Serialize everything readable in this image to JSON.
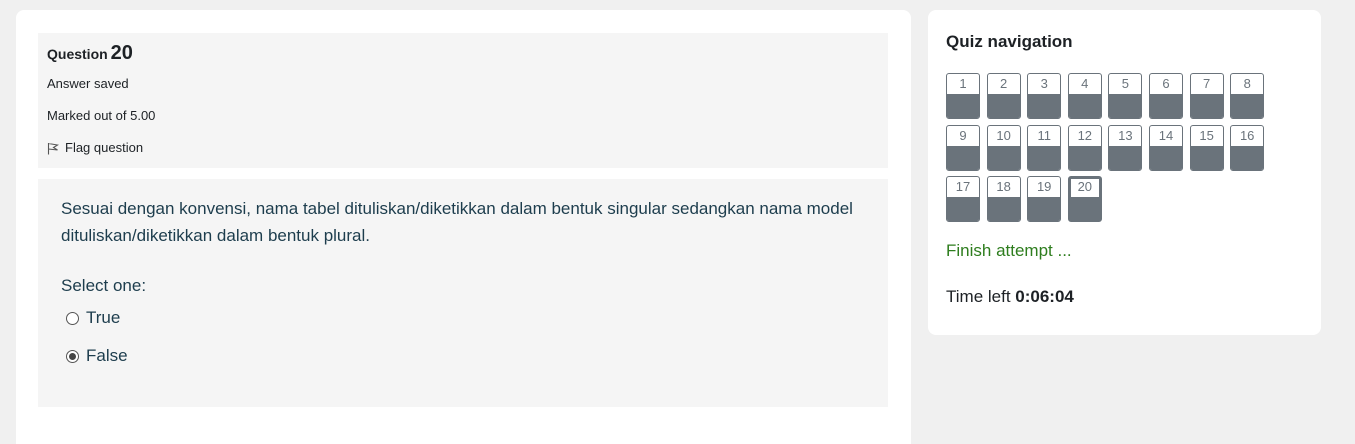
{
  "question": {
    "word": "Question",
    "number": "20",
    "state": "Answer saved",
    "grade": "Marked out of 5.00",
    "flag_label": "Flag question",
    "text": "Sesuai dengan konvensi, nama tabel dituliskan/diketikkan dalam bentuk singular sedangkan nama model dituliskan/diketikkan dalam bentuk plural.",
    "prompt": "Select one:",
    "options": [
      {
        "label": "True",
        "selected": false
      },
      {
        "label": "False",
        "selected": true
      }
    ]
  },
  "navigation": {
    "title": "Quiz navigation",
    "buttons": [
      "1",
      "2",
      "3",
      "4",
      "5",
      "6",
      "7",
      "8",
      "9",
      "10",
      "11",
      "12",
      "13",
      "14",
      "15",
      "16",
      "17",
      "18",
      "19",
      "20"
    ],
    "current": "20",
    "finish_label": "Finish attempt ...",
    "time_label": "Time left",
    "time_value": "0:06:04"
  },
  "colors": {
    "answered_fill": "#6a737b",
    "finish_link": "#2e7d1e",
    "question_text": "#1d3d4d"
  }
}
